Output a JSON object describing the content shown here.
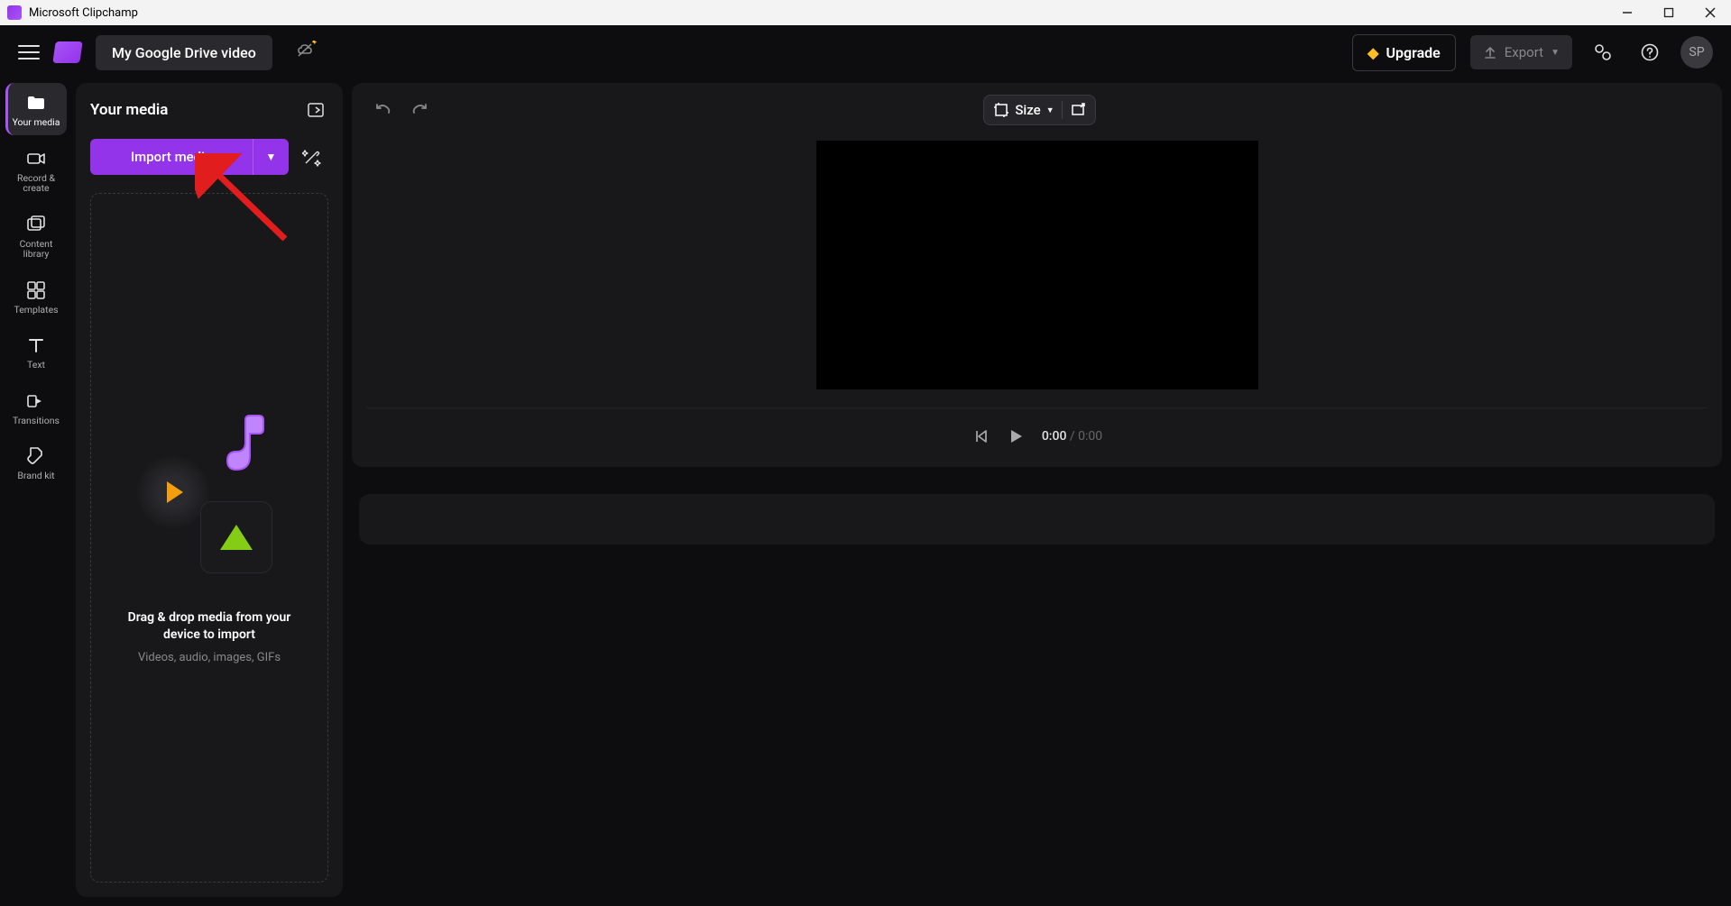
{
  "app": {
    "title": "Microsoft Clipchamp",
    "user_initials": "SP"
  },
  "topbar": {
    "project_title": "My Google Drive video",
    "upgrade_label": "Upgrade",
    "export_label": "Export"
  },
  "rail": {
    "items": [
      {
        "label": "Your media"
      },
      {
        "label": "Record & create"
      },
      {
        "label": "Content library"
      },
      {
        "label": "Templates"
      },
      {
        "label": "Text"
      },
      {
        "label": "Transitions"
      },
      {
        "label": "Brand kit"
      }
    ]
  },
  "panel": {
    "title": "Your media",
    "import_label": "Import media",
    "drop_title": "Drag & drop media from your device to import",
    "drop_sub": "Videos, audio, images, GIFs"
  },
  "preview": {
    "size_label": "Size"
  },
  "transport": {
    "current": "0:00",
    "separator": " / ",
    "total": "0:00"
  }
}
